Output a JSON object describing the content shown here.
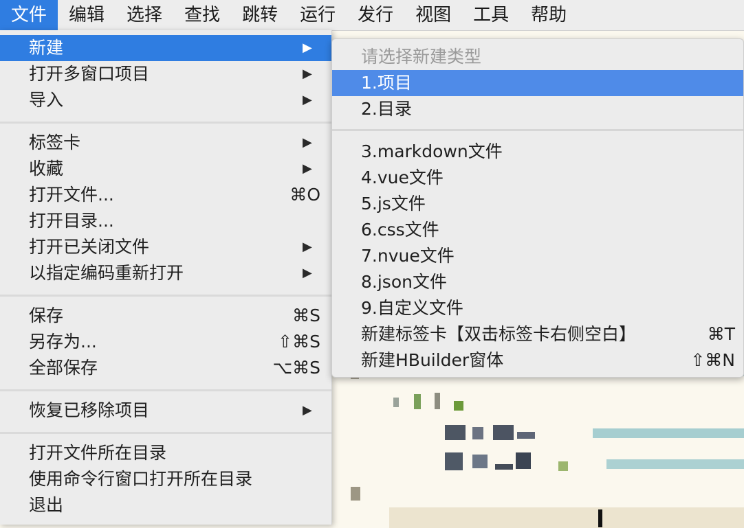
{
  "menubar": {
    "items": [
      {
        "label": "文件",
        "active": true
      },
      {
        "label": "编辑"
      },
      {
        "label": "选择"
      },
      {
        "label": "查找"
      },
      {
        "label": "跳转"
      },
      {
        "label": "运行"
      },
      {
        "label": "发行"
      },
      {
        "label": "视图"
      },
      {
        "label": "工具"
      },
      {
        "label": "帮助"
      }
    ]
  },
  "file_menu": {
    "items": [
      {
        "label": "新建",
        "submenu": true,
        "highlight": true
      },
      {
        "label": "打开多窗口项目",
        "submenu": true
      },
      {
        "label": "导入",
        "submenu": true
      },
      {
        "label": "标签卡",
        "submenu": true
      },
      {
        "label": "收藏",
        "submenu": true
      },
      {
        "label": "打开文件...",
        "shortcut": "⌘O"
      },
      {
        "label": "打开目录..."
      },
      {
        "label": "打开已关闭文件",
        "submenu": true
      },
      {
        "label": "以指定编码重新打开",
        "submenu": true
      },
      {
        "label": "保存",
        "shortcut": "⌘S"
      },
      {
        "label": "另存为...",
        "shortcut": "⇧⌘S"
      },
      {
        "label": "全部保存",
        "shortcut": "⌥⌘S"
      },
      {
        "label": "恢复已移除项目",
        "submenu": true
      },
      {
        "label": "打开文件所在目录"
      },
      {
        "label": "使用命令行窗口打开所在目录"
      },
      {
        "label": "退出"
      }
    ],
    "arrow_glyph": "▶"
  },
  "new_submenu": {
    "header": "请选择新建类型",
    "items": [
      {
        "label": "1.项目",
        "highlight": true
      },
      {
        "label": "2.目录"
      },
      {
        "label": "3.markdown文件"
      },
      {
        "label": "4.vue文件"
      },
      {
        "label": "5.js文件"
      },
      {
        "label": "6.css文件"
      },
      {
        "label": "7.nvue文件"
      },
      {
        "label": "8.json文件"
      },
      {
        "label": "9.自定义文件"
      },
      {
        "label": "新建标签卡【双击标签卡右侧空白】",
        "shortcut": "⌘T"
      },
      {
        "label": "新建HBuilder窗体",
        "shortcut": "⇧⌘N"
      }
    ]
  },
  "colors": {
    "accent": "#2f7de1",
    "submenu_highlight": "#4f8be8",
    "menu_bg": "#ececec",
    "editor_bg": "#fbf8ee"
  }
}
